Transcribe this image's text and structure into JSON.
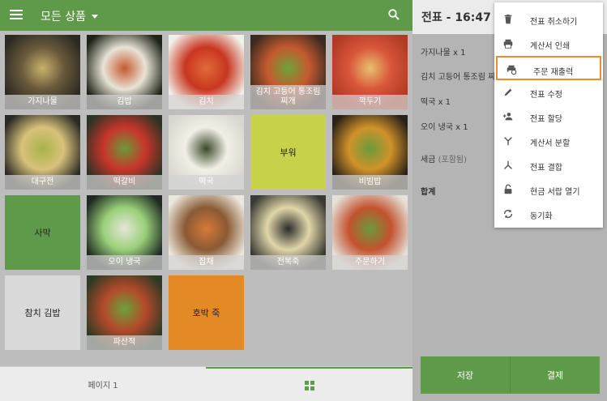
{
  "topbar": {
    "category_label": "모든 상품"
  },
  "tiles": [
    {
      "label": "가지나물",
      "kind": "photo",
      "palette": [
        "#2b2a22",
        "#6a5a3c",
        "#c9b26a"
      ]
    },
    {
      "label": "김밥",
      "kind": "photo",
      "palette": [
        "#1d2316",
        "#e8e3d6",
        "#c55a2f"
      ]
    },
    {
      "label": "김치",
      "kind": "photo",
      "palette": [
        "#f2f0ea",
        "#c8361f",
        "#e26a3a"
      ]
    },
    {
      "label": "김치 고등어 통조림 찌개",
      "kind": "photo",
      "palette": [
        "#3a2a1f",
        "#c55a2f",
        "#6ea23a"
      ]
    },
    {
      "label": "깍두기",
      "kind": "photo",
      "palette": [
        "#b03a24",
        "#d9563a",
        "#e8c070"
      ]
    },
    {
      "label": "대구전",
      "kind": "photo",
      "palette": [
        "#2a2a24",
        "#d8c27a",
        "#a8b24a"
      ]
    },
    {
      "label": "떡갈비",
      "kind": "photo",
      "palette": [
        "#2c3424",
        "#c8352a",
        "#6a9a3a"
      ]
    },
    {
      "label": "떡국",
      "kind": "photo",
      "palette": [
        "#d8d6cf",
        "#f2efe6",
        "#3a4a2a"
      ]
    },
    {
      "label": "부워",
      "kind": "plain",
      "color": "#c7d24a"
    },
    {
      "label": "비빔밥",
      "kind": "photo",
      "palette": [
        "#2a2218",
        "#d0922a",
        "#6a9a3a"
      ]
    },
    {
      "label": "사막",
      "kind": "plain",
      "color": "#5f9a4a"
    },
    {
      "label": "오이 냉국",
      "kind": "photo",
      "palette": [
        "#1e2a22",
        "#9ad07a",
        "#e6e6d8"
      ]
    },
    {
      "label": "잡채",
      "kind": "photo",
      "palette": [
        "#ebe8dd",
        "#8a5a34",
        "#d7793a"
      ]
    },
    {
      "label": "전복죽",
      "kind": "photo",
      "palette": [
        "#3a3a34",
        "#e0d6a8",
        "#2c2c2c"
      ]
    },
    {
      "label": "주문하기",
      "kind": "photo",
      "palette": [
        "#e4e1d8",
        "#c4522f",
        "#6a9a3a"
      ]
    },
    {
      "label": "참치 김밥",
      "kind": "plain",
      "color": "#d9d9d9"
    },
    {
      "label": "파산적",
      "kind": "photo",
      "palette": [
        "#2f3a24",
        "#b44a2a",
        "#6aa23a"
      ]
    },
    {
      "label": "호박 죽",
      "kind": "plain",
      "color": "#e38a26"
    }
  ],
  "footer": {
    "page_label": "페이지 1"
  },
  "ticket": {
    "title": "전표 - 16:47",
    "orders": [
      "가지나물 x 1",
      "김치 고등어 통조림 찌개 x 1",
      "떡국 x 1",
      "오이 냉국 x 1"
    ],
    "tax_label": "세금",
    "tax_note": "(포함됨)",
    "total_label": "합계",
    "save_label": "저장",
    "pay_label": "결제"
  },
  "menu": {
    "items": [
      {
        "label": "전표 취소하기",
        "icon": "trash-icon"
      },
      {
        "label": "계산서 인쇄",
        "icon": "printer-icon"
      },
      {
        "label": "주문 재출력",
        "icon": "reprint-icon"
      },
      {
        "label": "전표 수정",
        "icon": "pencil-icon"
      },
      {
        "label": "전표 할당",
        "icon": "assign-person-icon"
      },
      {
        "label": "계산서 분할",
        "icon": "split-icon"
      },
      {
        "label": "전표 결합",
        "icon": "merge-icon"
      },
      {
        "label": "현금 서랍 열기",
        "icon": "lock-open-icon"
      },
      {
        "label": "동기화",
        "icon": "sync-icon"
      }
    ],
    "active_index": 2,
    "highlight_color": "#f08a2b"
  },
  "colors": {
    "accent": "#5f9a4a"
  }
}
